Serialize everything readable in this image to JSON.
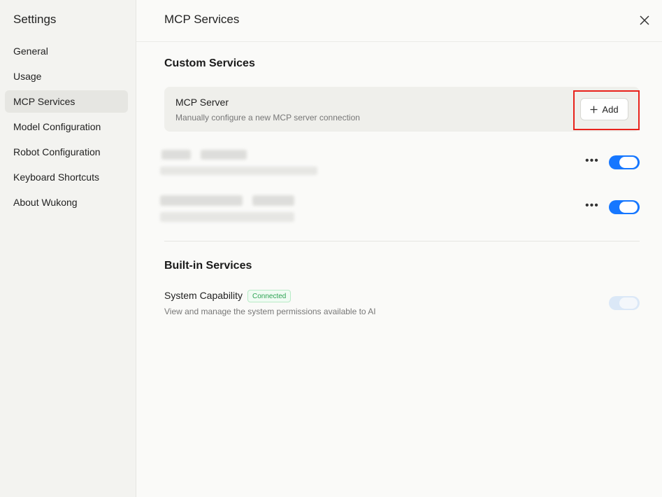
{
  "sidebar": {
    "title": "Settings",
    "items": [
      {
        "label": "General"
      },
      {
        "label": "Usage"
      },
      {
        "label": "MCP Services"
      },
      {
        "label": "Model Configuration"
      },
      {
        "label": "Robot Configuration"
      },
      {
        "label": "Keyboard Shortcuts"
      },
      {
        "label": "About Wukong"
      }
    ],
    "active_index": 2
  },
  "header": {
    "title": "MCP Services",
    "close_icon": "close-icon"
  },
  "custom_services": {
    "heading": "Custom Services",
    "server_card": {
      "name": "MCP Server",
      "description": "Manually configure a new MCP server connection",
      "add_label": "Add",
      "add_icon": "plus-icon"
    },
    "entries": [
      {
        "enabled": true
      },
      {
        "enabled": true
      }
    ]
  },
  "builtin_services": {
    "heading": "Built-in Services",
    "items": [
      {
        "name": "System Capability",
        "badge": "Connected",
        "description": "View and manage the system permissions available to AI",
        "enabled": true,
        "disabled": true
      }
    ]
  },
  "colors": {
    "accent": "#1677ff",
    "highlight": "#e8221b",
    "badge_green": "#2ca352"
  }
}
